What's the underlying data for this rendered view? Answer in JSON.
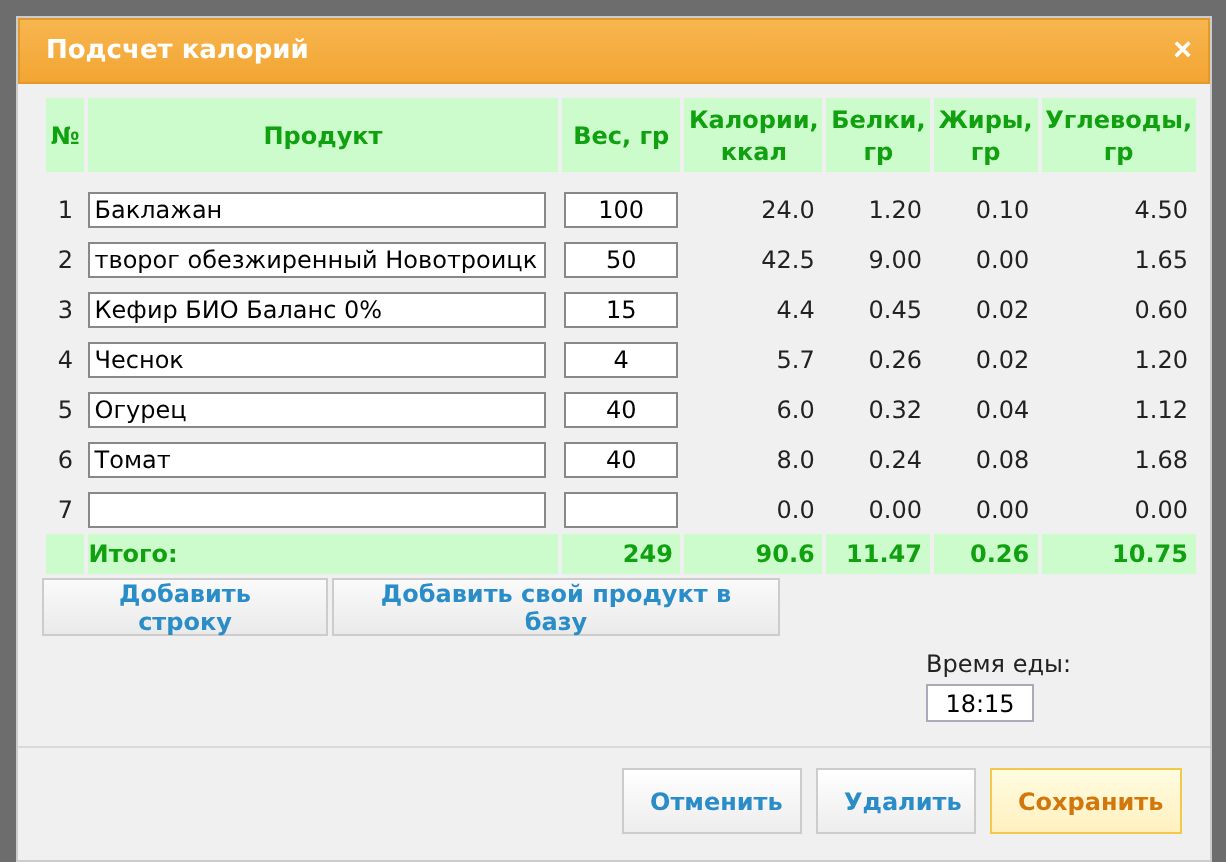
{
  "window": {
    "title": "Подсчет калорий",
    "close": "×"
  },
  "table": {
    "columns": [
      "№",
      "Продукт",
      "Вес, гр",
      "Калории, ккал",
      "Белки, гр",
      "Жиры, гр",
      "Углеводы, гр"
    ],
    "rows": [
      {
        "number": "1",
        "product": "Баклажан",
        "weight": "100",
        "calories": "24.0",
        "protein": "1.20",
        "fat": "0.10",
        "carbs": "4.50"
      },
      {
        "number": "2",
        "product": "творог обезжиренный Новотроицк",
        "weight": "50",
        "calories": "42.5",
        "protein": "9.00",
        "fat": "0.00",
        "carbs": "1.65"
      },
      {
        "number": "3",
        "product": "Кефир БИО Баланс 0%",
        "weight": "15",
        "calories": "4.4",
        "protein": "0.45",
        "fat": "0.02",
        "carbs": "0.60"
      },
      {
        "number": "4",
        "product": "Чеснок",
        "weight": "4",
        "calories": "5.7",
        "protein": "0.26",
        "fat": "0.02",
        "carbs": "1.20"
      },
      {
        "number": "5",
        "product": "Огурец",
        "weight": "40",
        "calories": "6.0",
        "protein": "0.32",
        "fat": "0.04",
        "carbs": "1.12"
      },
      {
        "number": "6",
        "product": "Томат",
        "weight": "40",
        "calories": "8.0",
        "protein": "0.24",
        "fat": "0.08",
        "carbs": "1.68"
      },
      {
        "number": "7",
        "calories": "0.0",
        "protein": "0.00",
        "fat": "0.00",
        "carbs": "0.00"
      }
    ],
    "totals": {
      "label": "Итого:",
      "weight": "249",
      "calories": "90.6",
      "protein": "11.47",
      "fat": "0.26",
      "carbs": "10.75"
    }
  },
  "table_buttons": [
    "Добавить строку",
    "Добавить свой продукт в базу"
  ],
  "meal_time": {
    "label": "Время еды:",
    "value": "18:15"
  },
  "footer_buttons": [
    {
      "label": "Отменить",
      "primary": false
    },
    {
      "label": "Удалить",
      "primary": false
    },
    {
      "label": "Сохранить",
      "primary": true
    }
  ]
}
